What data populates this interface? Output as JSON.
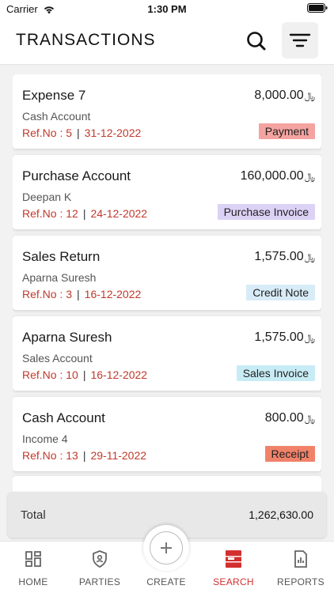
{
  "status_bar": {
    "carrier": "Carrier",
    "time": "1:30 PM"
  },
  "header": {
    "title": "TRANSACTIONS"
  },
  "currency_symbol": "﷼",
  "transactions": [
    {
      "title": "Expense 7",
      "amount": "8,000.00",
      "account": "Cash Account",
      "ref": "Ref.No : 5",
      "date": "31-12-2022",
      "type": "Payment",
      "badge_color": "#f4a3a0"
    },
    {
      "title": "Purchase Account",
      "amount": "160,000.00",
      "account": "Deepan K",
      "ref": "Ref.No : 12",
      "date": "24-12-2022",
      "type": "Purchase Invoice",
      "badge_color": "#dcd2f5"
    },
    {
      "title": "Sales Return",
      "amount": "1,575.00",
      "account": "Aparna Suresh",
      "ref": "Ref.No : 3",
      "date": "16-12-2022",
      "type": "Credit Note",
      "badge_color": "#d8ecf8"
    },
    {
      "title": "Aparna Suresh",
      "amount": "1,575.00",
      "account": "Sales Account",
      "ref": "Ref.No : 10",
      "date": "16-12-2022",
      "type": "Sales Invoice",
      "badge_color": "#c8ecf5"
    },
    {
      "title": "Cash Account",
      "amount": "800.00",
      "account": "Income 4",
      "ref": "Ref.No : 13",
      "date": "29-11-2022",
      "type": "Receipt",
      "badge_color": "#f0826a"
    }
  ],
  "total": {
    "label": "Total",
    "value": "1,262,630.00"
  },
  "tabs": [
    {
      "label": "HOME",
      "icon": "home-grid-icon",
      "active": false
    },
    {
      "label": "PARTIES",
      "icon": "shield-user-icon",
      "active": false
    },
    {
      "label": "CREATE",
      "icon": "plus-icon",
      "active": false
    },
    {
      "label": "SEARCH",
      "icon": "search-list-icon",
      "active": true
    },
    {
      "label": "REPORTS",
      "icon": "report-icon",
      "active": false
    }
  ],
  "colors": {
    "accent_red": "#d32f2f",
    "ref_red": "#c0392b"
  }
}
